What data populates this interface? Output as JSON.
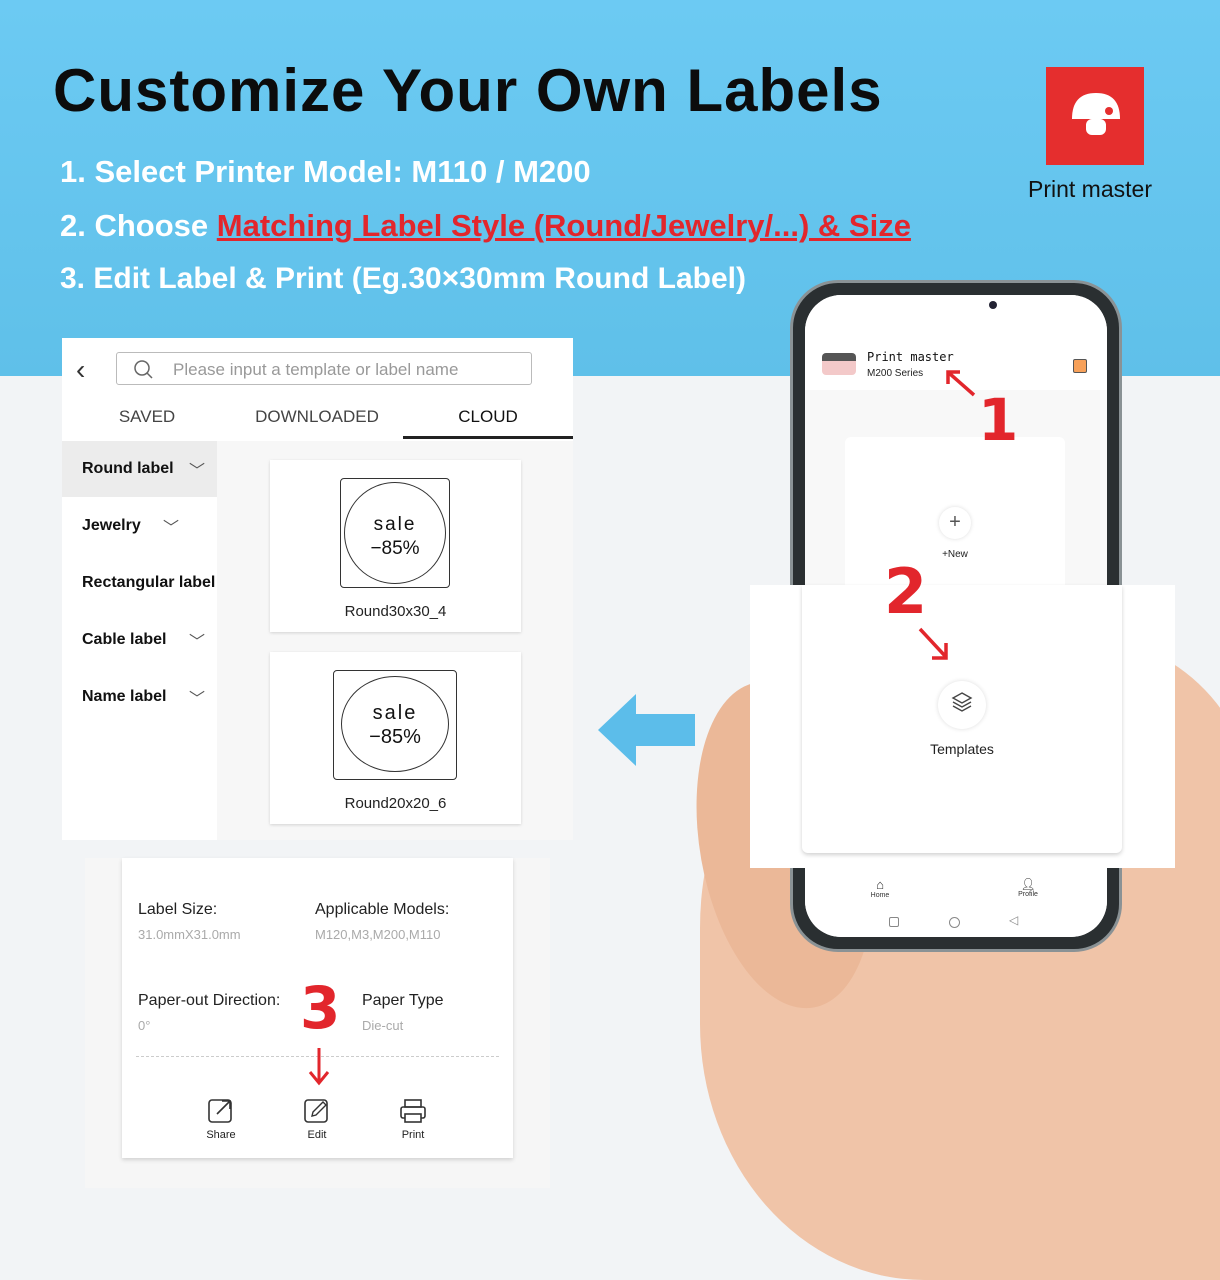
{
  "title": "Customize Your Own Labels",
  "steps": [
    {
      "prefix": "1. Select Printer Model: M110 / M200",
      "highlight": ""
    },
    {
      "prefix": "2. Choose ",
      "highlight": "Matching Label Style (Round/Jewelry/...) & Size"
    },
    {
      "prefix": "3. Edit Label & Print (Eg.30×30mm Round Label)",
      "highlight": ""
    }
  ],
  "brand": {
    "name": "Print master",
    "color": "#e52e2e"
  },
  "app": {
    "search_placeholder": "Please input a template or label name",
    "tabs": [
      {
        "label": "SAVED"
      },
      {
        "label": "DOWNLOADED"
      },
      {
        "label": "CLOUD",
        "active": true
      }
    ],
    "categories": [
      {
        "label": "Round label",
        "active": true
      },
      {
        "label": "Jewelry"
      },
      {
        "label": "Rectangular label"
      },
      {
        "label": "Cable label"
      },
      {
        "label": "Name label"
      }
    ],
    "templates": [
      {
        "line1": "sale",
        "line2": "−85%",
        "name": "Round30x30_4"
      },
      {
        "line1": "sale",
        "line2": "−85%",
        "name": "Round20x20_6"
      }
    ]
  },
  "details": {
    "label_size_key": "Label Size:",
    "label_size": "31.0mmX31.0mm",
    "models_key": "Applicable Models:",
    "models": "M120,M3,M200,M110",
    "direction_key": "Paper-out Direction:",
    "direction": "0°",
    "paper_key": "Paper Type",
    "paper": "Die-cut",
    "actions": [
      "Share",
      "Edit",
      "Print"
    ]
  },
  "phone": {
    "app_name": "Print master",
    "series": "M200 Series",
    "new_label": "+New",
    "templates_label": "Templates",
    "nav": [
      "Home",
      "Profile"
    ]
  },
  "markers": [
    "1",
    "2",
    "3"
  ],
  "colors": {
    "accent_red": "#e2262c",
    "sky": "#6ccaf3",
    "arrow_blue": "#5cbdea"
  }
}
